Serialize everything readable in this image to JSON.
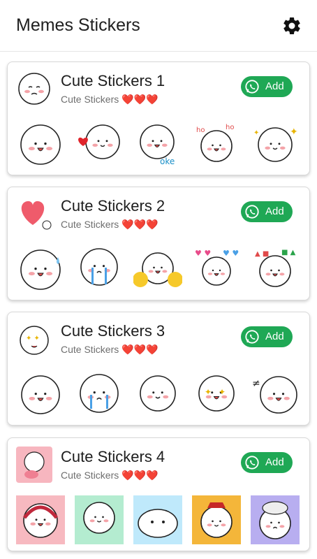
{
  "app": {
    "title": "Memes Stickers",
    "settings_icon": "gear-icon"
  },
  "colors": {
    "add_button": "#1fa855",
    "heart": "#e0242b",
    "blush": "#f4a3a8"
  },
  "packs": [
    {
      "name": "Cute Stickers 1",
      "author": "Cute Stickers ❤️❤️❤️",
      "add_label": "Add",
      "tray_icon": "sad-hand-face-sticker",
      "stickers": [
        "smiling-face-sticker",
        "heart-wink-sticker",
        "oke-sticker",
        "ho-ho-laugh-sticker",
        "sparkle-clap-sticker"
      ]
    },
    {
      "name": "Cute Stickers 2",
      "author": "Cute Stickers ❤️❤️❤️",
      "add_label": "Add",
      "tray_icon": "big-heart-sticker",
      "stickers": [
        "tongue-sweat-sticker",
        "crying-sticker",
        "pom-pom-cheer-sticker",
        "heart-confetti-sticker",
        "party-confetti-sticker"
      ]
    },
    {
      "name": "Cute Stickers 3",
      "author": "Cute Stickers ❤️❤️❤️",
      "add_label": "Add",
      "tray_icon": "sparkly-eyes-sticker",
      "stickers": [
        "shocked-face-sticker",
        "tearful-sticker",
        "whistling-sticker",
        "star-eyes-sticker",
        "surprised-sticker"
      ]
    },
    {
      "name": "Cute Stickers 4",
      "author": "Cute Stickers ❤️❤️❤️",
      "add_label": "Add",
      "tray_icon": "pig-hug-sticker",
      "stickers": [
        "headphones-sticker",
        "dancing-sticker",
        "blob-face-sticker",
        "lucky-hat-sticker",
        "turban-cleaning-sticker"
      ]
    }
  ]
}
